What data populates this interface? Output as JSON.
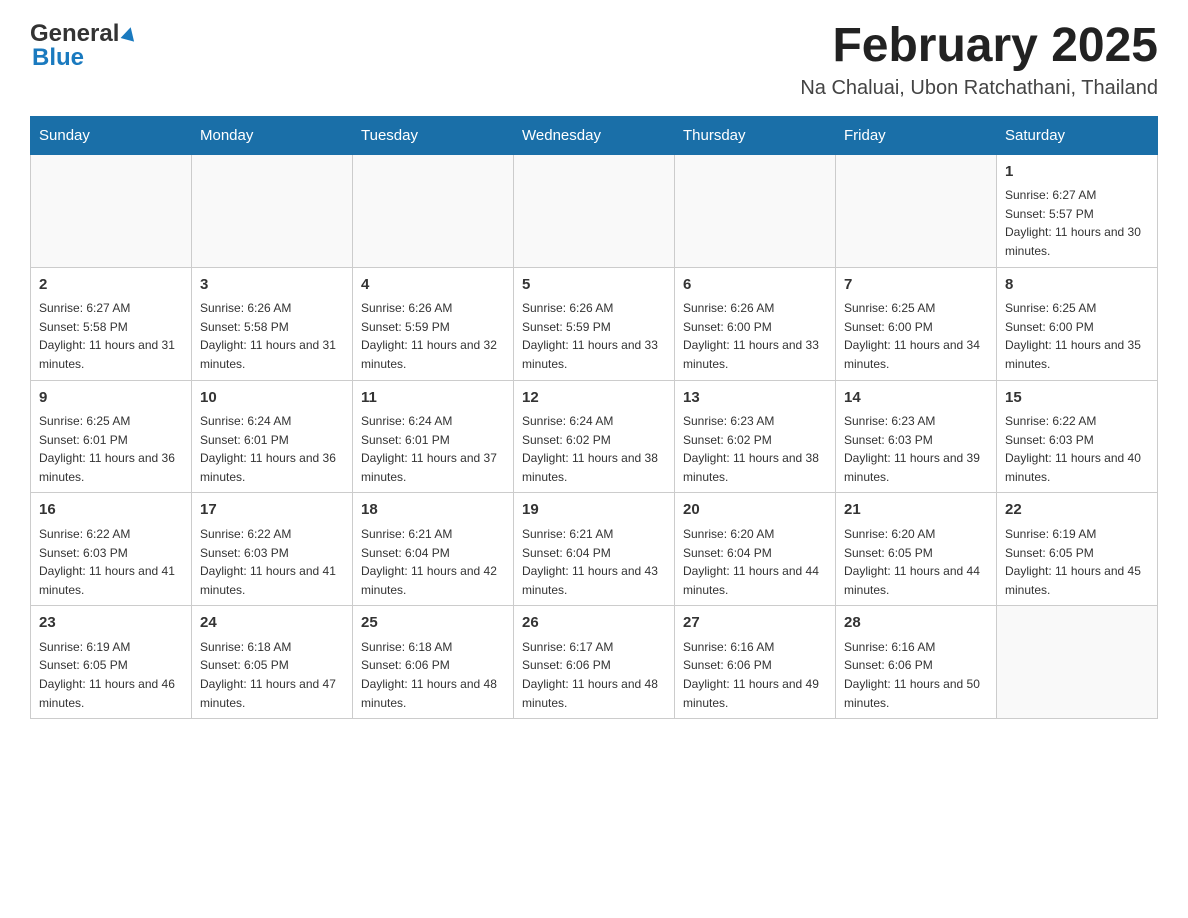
{
  "header": {
    "logo_general": "General",
    "logo_blue": "Blue",
    "month_title": "February 2025",
    "location": "Na Chaluai, Ubon Ratchathani, Thailand"
  },
  "days_of_week": [
    "Sunday",
    "Monday",
    "Tuesday",
    "Wednesday",
    "Thursday",
    "Friday",
    "Saturday"
  ],
  "weeks": [
    [
      {
        "day": "",
        "sunrise": "",
        "sunset": "",
        "daylight": ""
      },
      {
        "day": "",
        "sunrise": "",
        "sunset": "",
        "daylight": ""
      },
      {
        "day": "",
        "sunrise": "",
        "sunset": "",
        "daylight": ""
      },
      {
        "day": "",
        "sunrise": "",
        "sunset": "",
        "daylight": ""
      },
      {
        "day": "",
        "sunrise": "",
        "sunset": "",
        "daylight": ""
      },
      {
        "day": "",
        "sunrise": "",
        "sunset": "",
        "daylight": ""
      },
      {
        "day": "1",
        "sunrise": "Sunrise: 6:27 AM",
        "sunset": "Sunset: 5:57 PM",
        "daylight": "Daylight: 11 hours and 30 minutes."
      }
    ],
    [
      {
        "day": "2",
        "sunrise": "Sunrise: 6:27 AM",
        "sunset": "Sunset: 5:58 PM",
        "daylight": "Daylight: 11 hours and 31 minutes."
      },
      {
        "day": "3",
        "sunrise": "Sunrise: 6:26 AM",
        "sunset": "Sunset: 5:58 PM",
        "daylight": "Daylight: 11 hours and 31 minutes."
      },
      {
        "day": "4",
        "sunrise": "Sunrise: 6:26 AM",
        "sunset": "Sunset: 5:59 PM",
        "daylight": "Daylight: 11 hours and 32 minutes."
      },
      {
        "day": "5",
        "sunrise": "Sunrise: 6:26 AM",
        "sunset": "Sunset: 5:59 PM",
        "daylight": "Daylight: 11 hours and 33 minutes."
      },
      {
        "day": "6",
        "sunrise": "Sunrise: 6:26 AM",
        "sunset": "Sunset: 6:00 PM",
        "daylight": "Daylight: 11 hours and 33 minutes."
      },
      {
        "day": "7",
        "sunrise": "Sunrise: 6:25 AM",
        "sunset": "Sunset: 6:00 PM",
        "daylight": "Daylight: 11 hours and 34 minutes."
      },
      {
        "day": "8",
        "sunrise": "Sunrise: 6:25 AM",
        "sunset": "Sunset: 6:00 PM",
        "daylight": "Daylight: 11 hours and 35 minutes."
      }
    ],
    [
      {
        "day": "9",
        "sunrise": "Sunrise: 6:25 AM",
        "sunset": "Sunset: 6:01 PM",
        "daylight": "Daylight: 11 hours and 36 minutes."
      },
      {
        "day": "10",
        "sunrise": "Sunrise: 6:24 AM",
        "sunset": "Sunset: 6:01 PM",
        "daylight": "Daylight: 11 hours and 36 minutes."
      },
      {
        "day": "11",
        "sunrise": "Sunrise: 6:24 AM",
        "sunset": "Sunset: 6:01 PM",
        "daylight": "Daylight: 11 hours and 37 minutes."
      },
      {
        "day": "12",
        "sunrise": "Sunrise: 6:24 AM",
        "sunset": "Sunset: 6:02 PM",
        "daylight": "Daylight: 11 hours and 38 minutes."
      },
      {
        "day": "13",
        "sunrise": "Sunrise: 6:23 AM",
        "sunset": "Sunset: 6:02 PM",
        "daylight": "Daylight: 11 hours and 38 minutes."
      },
      {
        "day": "14",
        "sunrise": "Sunrise: 6:23 AM",
        "sunset": "Sunset: 6:03 PM",
        "daylight": "Daylight: 11 hours and 39 minutes."
      },
      {
        "day": "15",
        "sunrise": "Sunrise: 6:22 AM",
        "sunset": "Sunset: 6:03 PM",
        "daylight": "Daylight: 11 hours and 40 minutes."
      }
    ],
    [
      {
        "day": "16",
        "sunrise": "Sunrise: 6:22 AM",
        "sunset": "Sunset: 6:03 PM",
        "daylight": "Daylight: 11 hours and 41 minutes."
      },
      {
        "day": "17",
        "sunrise": "Sunrise: 6:22 AM",
        "sunset": "Sunset: 6:03 PM",
        "daylight": "Daylight: 11 hours and 41 minutes."
      },
      {
        "day": "18",
        "sunrise": "Sunrise: 6:21 AM",
        "sunset": "Sunset: 6:04 PM",
        "daylight": "Daylight: 11 hours and 42 minutes."
      },
      {
        "day": "19",
        "sunrise": "Sunrise: 6:21 AM",
        "sunset": "Sunset: 6:04 PM",
        "daylight": "Daylight: 11 hours and 43 minutes."
      },
      {
        "day": "20",
        "sunrise": "Sunrise: 6:20 AM",
        "sunset": "Sunset: 6:04 PM",
        "daylight": "Daylight: 11 hours and 44 minutes."
      },
      {
        "day": "21",
        "sunrise": "Sunrise: 6:20 AM",
        "sunset": "Sunset: 6:05 PM",
        "daylight": "Daylight: 11 hours and 44 minutes."
      },
      {
        "day": "22",
        "sunrise": "Sunrise: 6:19 AM",
        "sunset": "Sunset: 6:05 PM",
        "daylight": "Daylight: 11 hours and 45 minutes."
      }
    ],
    [
      {
        "day": "23",
        "sunrise": "Sunrise: 6:19 AM",
        "sunset": "Sunset: 6:05 PM",
        "daylight": "Daylight: 11 hours and 46 minutes."
      },
      {
        "day": "24",
        "sunrise": "Sunrise: 6:18 AM",
        "sunset": "Sunset: 6:05 PM",
        "daylight": "Daylight: 11 hours and 47 minutes."
      },
      {
        "day": "25",
        "sunrise": "Sunrise: 6:18 AM",
        "sunset": "Sunset: 6:06 PM",
        "daylight": "Daylight: 11 hours and 48 minutes."
      },
      {
        "day": "26",
        "sunrise": "Sunrise: 6:17 AM",
        "sunset": "Sunset: 6:06 PM",
        "daylight": "Daylight: 11 hours and 48 minutes."
      },
      {
        "day": "27",
        "sunrise": "Sunrise: 6:16 AM",
        "sunset": "Sunset: 6:06 PM",
        "daylight": "Daylight: 11 hours and 49 minutes."
      },
      {
        "day": "28",
        "sunrise": "Sunrise: 6:16 AM",
        "sunset": "Sunset: 6:06 PM",
        "daylight": "Daylight: 11 hours and 50 minutes."
      },
      {
        "day": "",
        "sunrise": "",
        "sunset": "",
        "daylight": ""
      }
    ]
  ]
}
